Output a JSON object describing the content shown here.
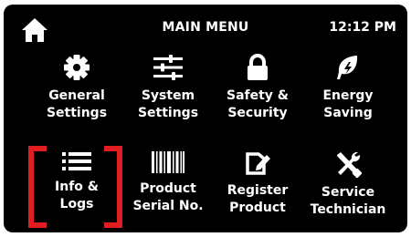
{
  "header": {
    "title": "MAIN MENU",
    "time": "12:12 PM"
  },
  "menu": [
    {
      "line1": "General",
      "line2": "Settings",
      "icon": "gear-icon"
    },
    {
      "line1": "System",
      "line2": "Settings",
      "icon": "sliders-icon"
    },
    {
      "line1": "Safety &",
      "line2": "Security",
      "icon": "lock-icon"
    },
    {
      "line1": "Energy",
      "line2": "Saving",
      "icon": "leaf-icon"
    },
    {
      "line1": "Info &",
      "line2": "Logs",
      "icon": "list-icon",
      "selected": true
    },
    {
      "line1": "Product",
      "line2": "Serial No.",
      "icon": "barcode-icon"
    },
    {
      "line1": "Register",
      "line2": "Product",
      "icon": "register-icon"
    },
    {
      "line1": "Service",
      "line2": "Technician",
      "icon": "tools-icon"
    }
  ],
  "colors": {
    "background": "#000000",
    "text": "#ffffff",
    "selection": "#e11c23"
  }
}
